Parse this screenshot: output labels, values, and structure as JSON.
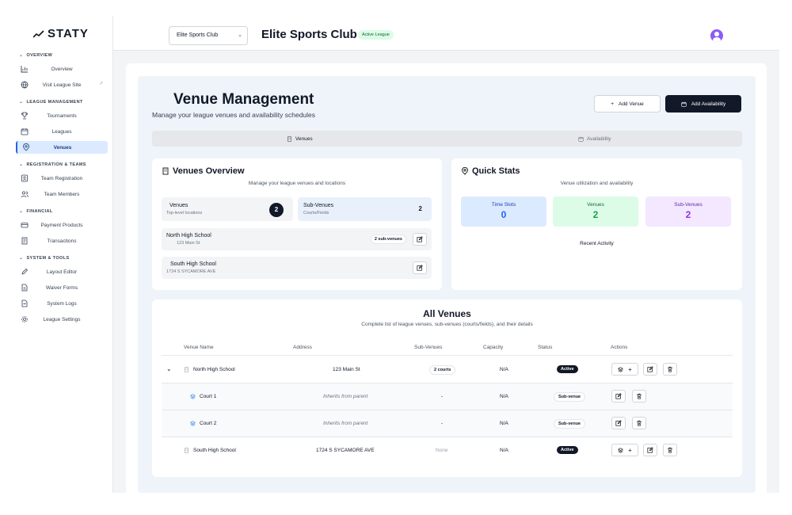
{
  "sidebar": {
    "logo": "STATY",
    "sections": {
      "overview": "OVERVIEW",
      "league_management": "LEAGUE MANAGEMENT",
      "registration": "REGISTRATION & TEAMS",
      "financial": "FINANCIAL",
      "system": "SYSTEM & TOOLS"
    },
    "items": {
      "overview": "Overview",
      "visit_site": "Visit League Site",
      "tournaments": "Tournaments",
      "leagues": "Leagues",
      "venues": "Venues",
      "team_registration": "Team Registration",
      "team_members": "Team Members",
      "payment_products": "Payment Products",
      "transactions": "Transactions",
      "layout_editor": "Layout Editor",
      "waiver_forms": "Waiver Forms",
      "system_logs": "System Logs",
      "league_settings": "League Settings"
    }
  },
  "topbar": {
    "club_select_value": "Elite Sports Club",
    "club_title": "Elite Sports Club",
    "league_badge": "Active League"
  },
  "page": {
    "title": "Venue Management",
    "subtitle": "Manage your league venues and availability schedules",
    "add_venue": "Add Venue",
    "add_availability": "Add Availability",
    "tabs": {
      "venues": "Venues",
      "availability": "Availability"
    }
  },
  "overview": {
    "title": "Venues Overview",
    "subtitle": "Manage your league venues and locations",
    "venues_label": "Venues",
    "venues_sub": "Top-level locations",
    "venues_count": "2",
    "subvenues_label": "Sub-Venues",
    "subvenues_sub": "Courts/Fields",
    "subvenues_count": "2",
    "list": [
      {
        "name": "North High School",
        "address": "123 Main St",
        "badge": "2 sub-venues"
      },
      {
        "name": "South High School",
        "address": "1724 S SYCAMORE AVE"
      }
    ]
  },
  "quick_stats": {
    "title": "Quick Stats",
    "subtitle": "Venue utilization and availability",
    "stats": [
      {
        "label": "Time Slots",
        "value": "0"
      },
      {
        "label": "Venues",
        "value": "2"
      },
      {
        "label": "Sub-Venues",
        "value": "2"
      }
    ],
    "recent_activity": "Recent Activity"
  },
  "all_venues": {
    "title": "All Venues",
    "subtitle": "Complete list of league venues, sub-venues (courts/fields), and their details",
    "headers": [
      "Venue Name",
      "Address",
      "Sub-Venues",
      "Capacity",
      "Status",
      "Actions"
    ],
    "rows": [
      {
        "name": "North High School",
        "address": "123 Main St",
        "subvenues": "2 courts",
        "capacity": "N/A",
        "status": "Active"
      },
      {
        "name": "Court 1",
        "address": "Inherits from parent",
        "subvenues": "-",
        "capacity": "N/A",
        "status": "Sub-venue"
      },
      {
        "name": "Court 2",
        "address": "Inherits from parent",
        "subvenues": "-",
        "capacity": "N/A",
        "status": "Sub-venue"
      },
      {
        "name": "South High School",
        "address": "1724 S SYCAMORE AVE",
        "subvenues": "None",
        "capacity": "N/A",
        "status": "Active"
      }
    ]
  },
  "colors": {
    "accent": "#2563eb",
    "active_nav_bg": "#dbeafe",
    "dark_button": "#111827",
    "time_slots_bg": "#dbeafe",
    "venues_bg": "#dcfce7",
    "subvenues_bg": "#f3e8ff"
  }
}
